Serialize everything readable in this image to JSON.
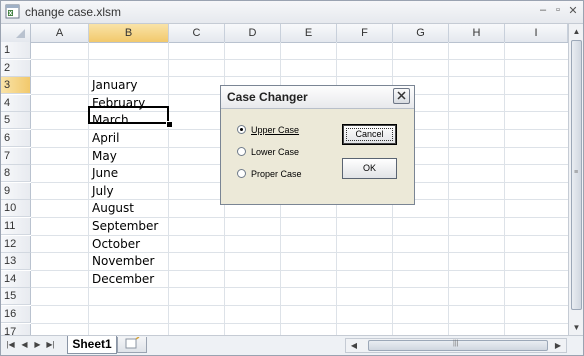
{
  "window": {
    "title": "change case.xlsm",
    "controls": [
      "minimize-icon",
      "restore-icon",
      "close-icon"
    ]
  },
  "grid": {
    "columns": [
      "A",
      "B",
      "C",
      "D",
      "E",
      "F",
      "G",
      "H",
      "I"
    ],
    "selected_column": "B",
    "rows": [
      "1",
      "2",
      "3",
      "4",
      "5",
      "6",
      "7",
      "8",
      "9",
      "10",
      "11",
      "12",
      "13",
      "14",
      "15",
      "16",
      "17"
    ],
    "selected_row": "3",
    "active_cell": "B3",
    "column_b_values": [
      {
        "row": "3",
        "value": "January"
      },
      {
        "row": "4",
        "value": "February"
      },
      {
        "row": "5",
        "value": "March"
      },
      {
        "row": "6",
        "value": "April"
      },
      {
        "row": "7",
        "value": "May"
      },
      {
        "row": "8",
        "value": "June"
      },
      {
        "row": "9",
        "value": "July"
      },
      {
        "row": "10",
        "value": "August"
      },
      {
        "row": "11",
        "value": "September"
      },
      {
        "row": "12",
        "value": "October"
      },
      {
        "row": "13",
        "value": "November"
      },
      {
        "row": "14",
        "value": "December"
      }
    ]
  },
  "dialog": {
    "title": "Case Changer",
    "options": [
      {
        "label": "Upper Case",
        "selected": true
      },
      {
        "label": "Lower Case",
        "selected": false
      },
      {
        "label": "Proper Case",
        "selected": false
      }
    ],
    "cancel_label": "Cancel",
    "ok_label": "OK"
  },
  "sheets": {
    "tabs": [
      "Sheet1"
    ],
    "active": "Sheet1"
  },
  "colors": {
    "selection_header": "#f2c96c",
    "dialog_bg": "#ece9d8",
    "gridline": "#dde2e8"
  }
}
